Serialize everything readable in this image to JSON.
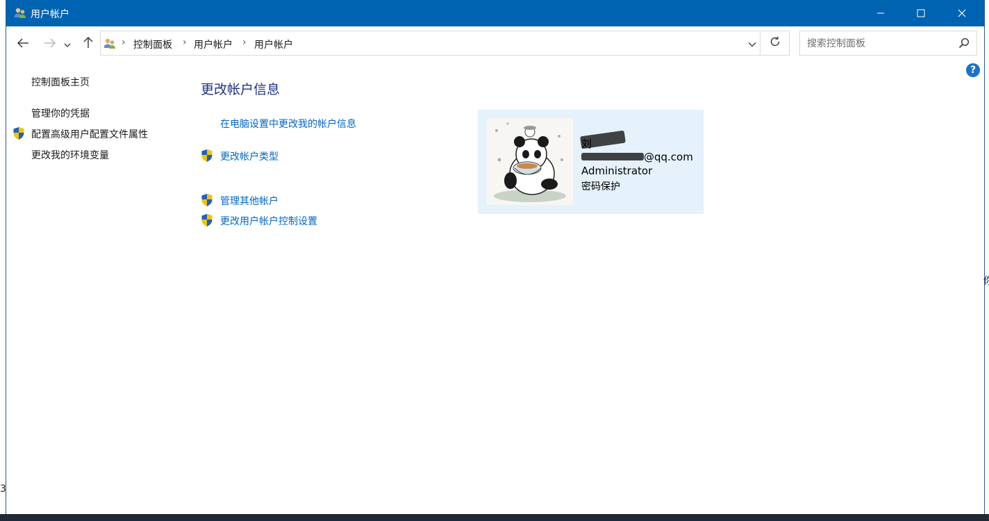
{
  "window": {
    "title": "用户帐户",
    "minimize_icon": "minimize-icon",
    "maximize_icon": "maximize-icon",
    "close_icon": "close-icon"
  },
  "navigation": {
    "breadcrumbs": [
      "控制面板",
      "用户帐户",
      "用户帐户"
    ],
    "search_placeholder": "搜索控制面板",
    "help_label": "?"
  },
  "sidebar": {
    "items": [
      {
        "label": "控制面板主页",
        "shield": false
      },
      {
        "label": "管理你的凭据",
        "shield": false
      },
      {
        "label": "配置高级用户配置文件属性",
        "shield": true
      },
      {
        "label": "更改我的环境变量",
        "shield": false
      }
    ]
  },
  "main": {
    "heading": "更改帐户信息",
    "tasks": [
      {
        "label": "在电脑设置中更改我的帐户信息",
        "shield": false
      },
      {
        "label": "更改帐户类型",
        "shield": true
      },
      {
        "label": "管理其他帐户",
        "shield": true
      },
      {
        "label": "更改用户帐户控制设置",
        "shield": true
      }
    ]
  },
  "user": {
    "name_visible": "刘",
    "email_suffix": "@qq.com",
    "role": "Administrator",
    "password_status": "密码保护"
  },
  "edges": {
    "right_char": "你",
    "left_char": "3"
  },
  "colors": {
    "titlebar": "#0063b1",
    "link": "#0066cc",
    "heading": "#1e3287",
    "panel": "#e5f1fb"
  }
}
